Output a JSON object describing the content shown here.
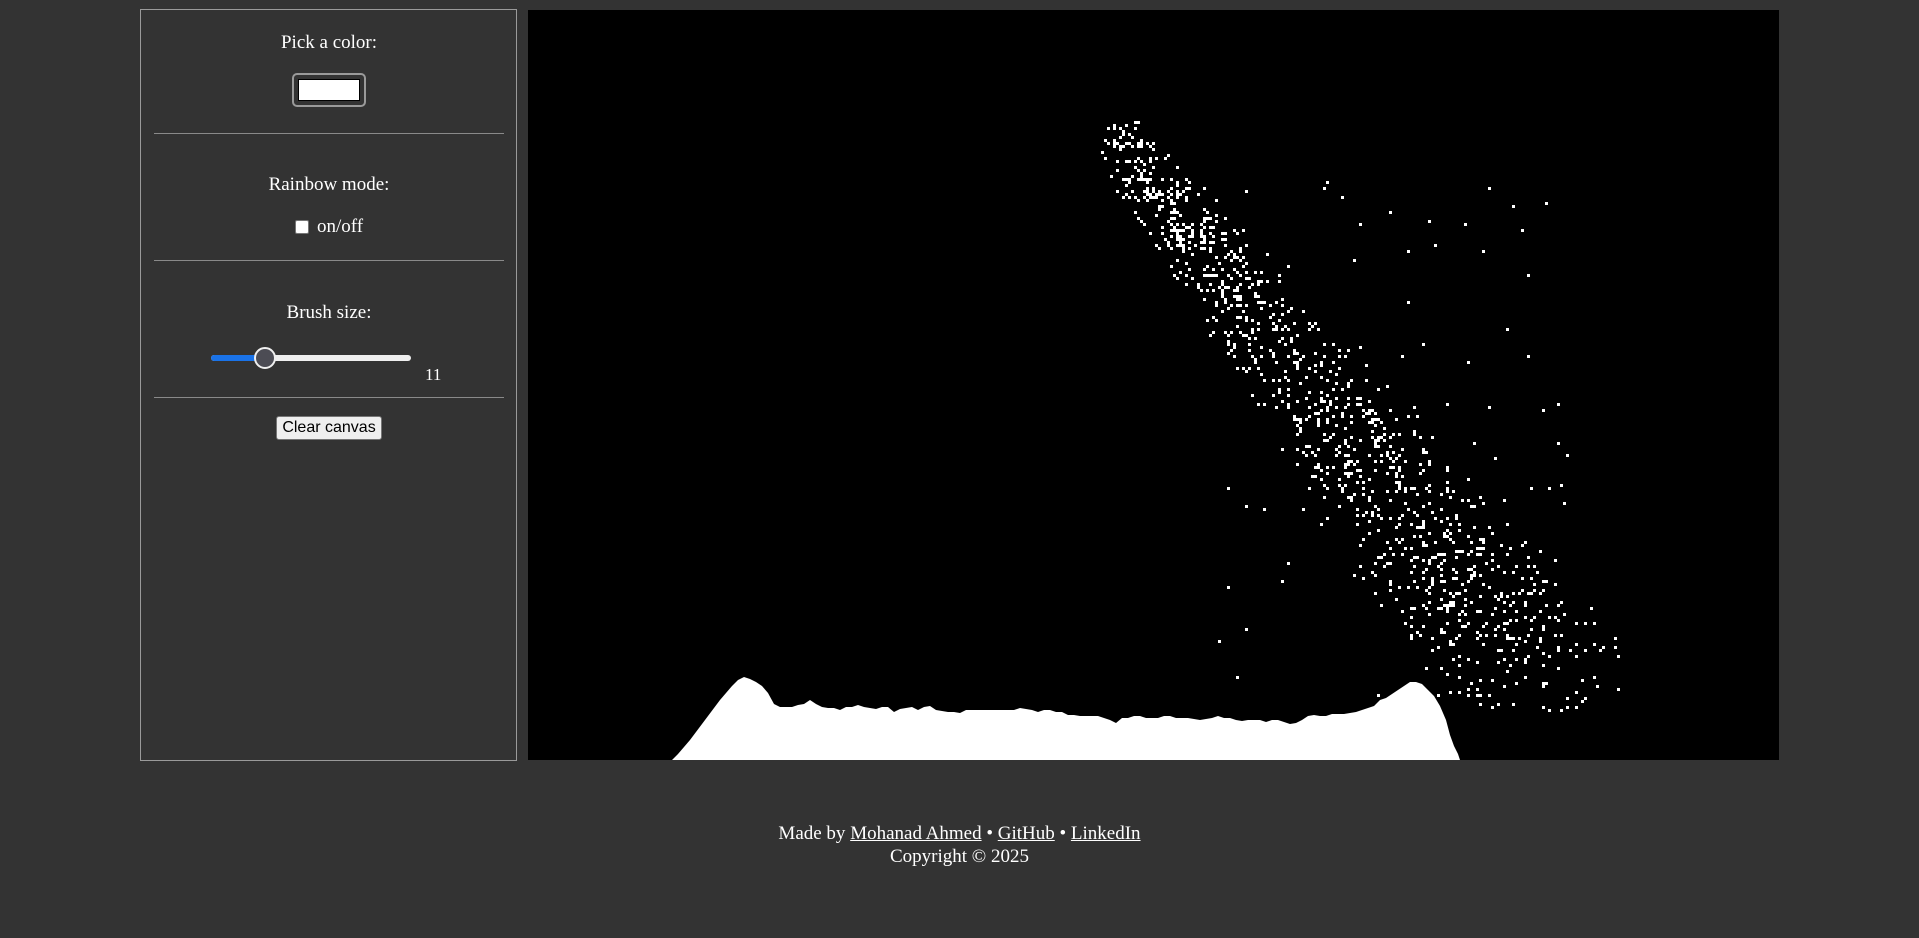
{
  "controls": {
    "color_label": "Pick a color:",
    "color_value": "#ffffff",
    "rainbow_label": "Rainbow mode:",
    "rainbow_checkbox_label": "on/off",
    "rainbow_checked": false,
    "brush_label": "Brush size:",
    "brush_value": "11",
    "brush_fraction": 0.24,
    "clear_button": "Clear canvas"
  },
  "canvas": {
    "background": "#000000",
    "sand_color": "#ffffff"
  },
  "footer": {
    "made_by_prefix": "Made by",
    "author_link": "Mohanad Ahmed",
    "sep1": "•",
    "github_link": "GitHub",
    "sep2": "•",
    "linkedin_link": "LinkedIn",
    "copyright": "Copyright © 2025"
  },
  "colors": {
    "page_background": "#333333",
    "slider_accent": "#1a73e8"
  }
}
